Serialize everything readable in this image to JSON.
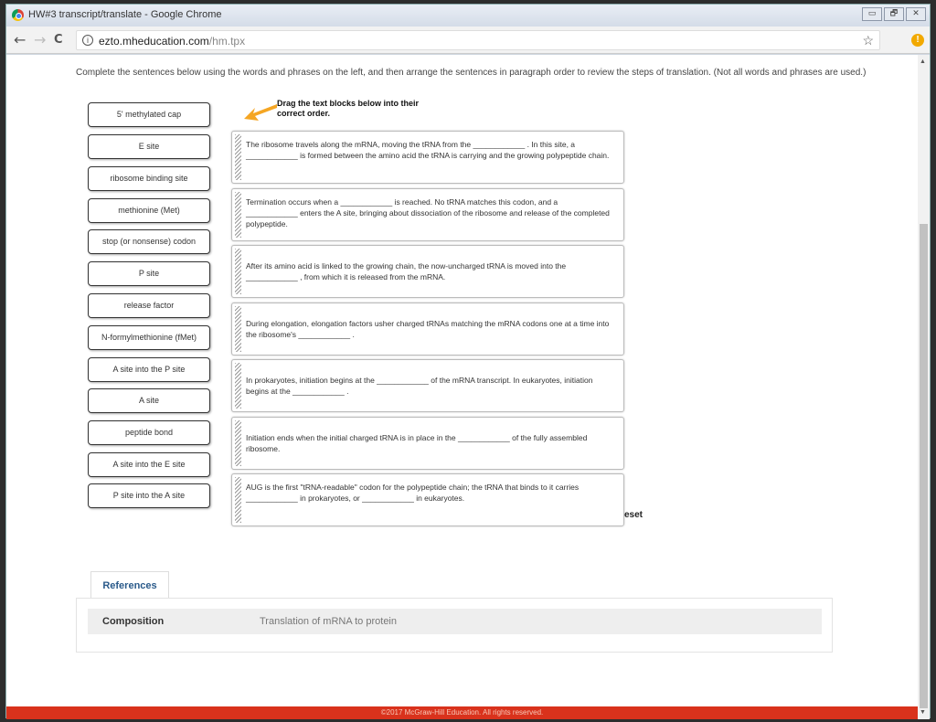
{
  "window": {
    "title": "HW#3 transcript/translate - Google Chrome",
    "controls": [
      "▭",
      "🗗",
      "✕"
    ]
  },
  "toolbar": {
    "back": "←",
    "forward": "→",
    "reload": "C",
    "url_host": "ezto.mheducation.com",
    "url_path": "/hm.tpx",
    "star": "☆",
    "extension_badge": "!"
  },
  "instructions": "Complete the sentences below using the words and phrases on the left, and then arrange the sentences in paragraph order to review the steps of translation. (Not all words and phrases are used.)",
  "drag_hint": {
    "line1": "Drag the text blocks below into their",
    "line2": "correct order."
  },
  "word_bank": [
    "5' methylated cap",
    "E site",
    "ribosome binding site",
    "methionine (Met)",
    "stop (or nonsense) codon",
    "P site",
    "release factor",
    "N-formylmethionine (fMet)",
    "A site into the P site",
    "A site",
    "peptide bond",
    "A site into the E site",
    "P site into the A site"
  ],
  "blocks": [
    "The ribosome travels along the mRNA, moving the tRNA from the ____________ . In this site, a ____________ is formed between the amino acid the tRNA is carrying and the growing polypeptide chain.",
    "Termination occurs when a ____________ is reached. No tRNA matches this codon, and a ____________ enters the A site, bringing about dissociation of the ribosome and release of the completed polypeptide.",
    "After its amino acid is linked to the growing chain, the now-uncharged tRNA is moved into the ____________ , from which it is released from the mRNA.",
    "During elongation, elongation factors usher charged tRNAs matching the mRNA codons one at a time into the ribosome's ____________ .",
    "In prokaryotes, initiation begins at the ____________ of the mRNA transcript. In eukaryotes, initiation begins at the ____________ .",
    "Initiation ends when the initial charged tRNA is in place in the ____________ of the fully assembled ribosome.",
    "AUG is the first \"tRNA-readable\" codon for the polypeptide chain; the tRNA that binds to it carries ____________ in prokaryotes, or ____________ in eukaryotes."
  ],
  "reset_label": "eset",
  "references": {
    "tab": "References",
    "key": "Composition",
    "value": "Translation of mRNA to protein"
  },
  "footer": "©2017 McGraw-Hill Education. All rights reserved.",
  "colors": {
    "footer": "#d9321c",
    "arrow": "#f5a623",
    "reference_tab_text": "#2a5a8a"
  }
}
